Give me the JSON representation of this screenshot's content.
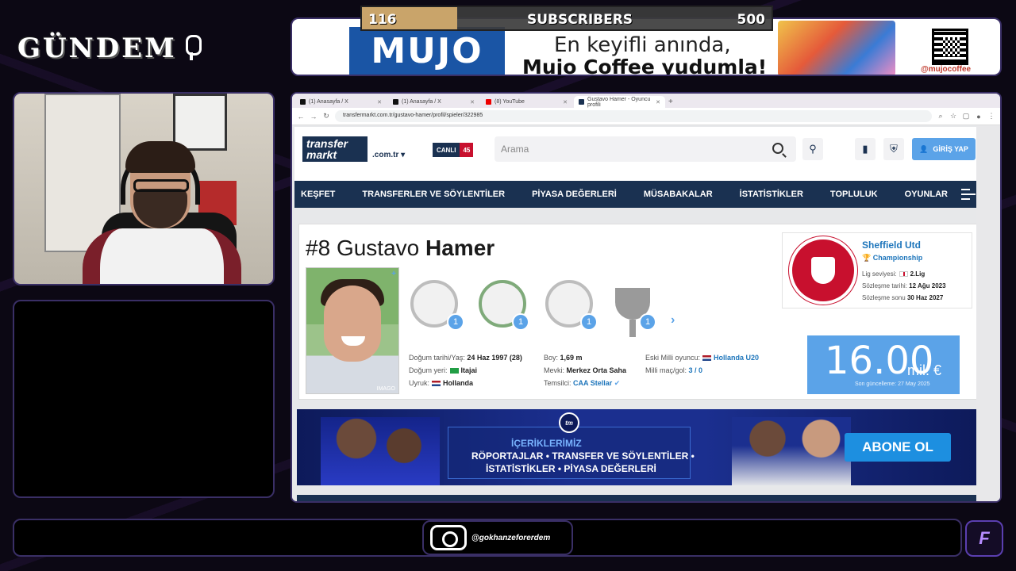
{
  "brand": {
    "title": "GÜNDEM"
  },
  "subscribers": {
    "current": "116",
    "label": "SUBSCRIBERS",
    "goal": "500",
    "progress": 0.232
  },
  "ad": {
    "brand": "MUJO",
    "line1": "En keyifli anında,",
    "line2": "Mujo Coffee yudumla!",
    "handle": "@mujocoffee"
  },
  "browser": {
    "tabs": [
      {
        "label": "(1) Anasayfa / X",
        "icon": "x-icon"
      },
      {
        "label": "(1) Anasayfa / X",
        "icon": "x-icon"
      },
      {
        "label": "(8) YouTube",
        "icon": "youtube-icon"
      },
      {
        "label": "Gustavo Hamer - Oyuncu profili",
        "icon": "transfermarkt-icon"
      }
    ],
    "url": "transfermarkt.com.tr/gustavo-hamer/profil/spieler/322985"
  },
  "tm": {
    "logo_line1": "transfer",
    "logo_line2": "markt",
    "domain": ".com.tr",
    "live_label": "CANLI",
    "live_count": "45",
    "search_placeholder": "Arama",
    "login_label": "GİRİŞ YAP",
    "nav": [
      "KEŞFET",
      "TRANSFERLER VE SÖYLENTİLER",
      "PİYASA DEĞERLERİ",
      "MÜSABAKALAR",
      "İSTATİSTİKLER",
      "TOPLULUK",
      "OYUNLAR"
    ]
  },
  "player": {
    "number": "#8",
    "first_name": "Gustavo",
    "last_name": "Hamer",
    "photo_credit": "IMAGO",
    "trophy_counts": [
      "1",
      "1",
      "1",
      "1"
    ],
    "facts": {
      "dob_label": "Doğum tarihi/Yaş:",
      "dob": "24 Haz 1997 (28)",
      "pob_label": "Doğum yeri:",
      "pob": "Itajai",
      "nat_label": "Uyruk:",
      "nat": "Hollanda",
      "height_label": "Boy:",
      "height": "1,69 m",
      "pos_label": "Mevki:",
      "pos": "Merkez Orta Saha",
      "agent_label": "Temsilci:",
      "agent": "CAA Stellar",
      "former_label": "Eski Milli oyuncu:",
      "former": "Hollanda U20",
      "caps_label": "Milli maç/gol:",
      "caps": "3 / 0"
    },
    "club": {
      "name": "Sheffield Utd",
      "league": "Championship",
      "level_label": "Lig seviyesi:",
      "level": "2.Lig",
      "joined_label": "Sözleşme tarihi:",
      "joined": "12 Ağu 2023",
      "expires_label": "Sözleşme sonu",
      "expires": "30 Haz 2027"
    },
    "value": {
      "amount": "16.00",
      "unit": "mil. €",
      "updated": "Son güncelleme: 27 May 2025"
    }
  },
  "promo": {
    "logo": "tm",
    "heading": "İÇERİKLERİMİZ",
    "line1": "RÖPORTAJLAR • TRANSFER VE SÖYLENTİLER •",
    "line2": "İSTATİSTİKLER • PİYASA DEĞERLERİ",
    "cta": "ABONE OL"
  },
  "social": {
    "instagram": "@gokhanzeforerdem"
  },
  "corner_logo": "F"
}
